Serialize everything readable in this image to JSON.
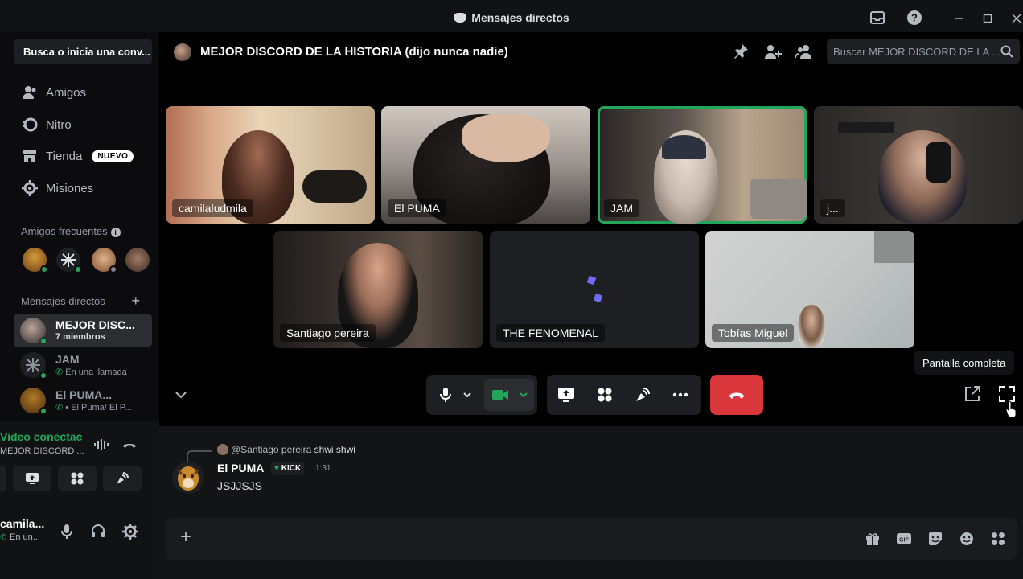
{
  "window": {
    "title": "Mensajes directos"
  },
  "sidebar": {
    "search_label": "Busca o inicia una conv...",
    "nav": [
      {
        "label": "Amigos",
        "icon": "friends-icon"
      },
      {
        "label": "Nitro",
        "icon": "nitro-icon"
      },
      {
        "label": "Tienda",
        "icon": "shop-icon",
        "badge": "NUEVO"
      },
      {
        "label": "Misiones",
        "icon": "quests-icon"
      }
    ],
    "frequent_header": "Amigos frecuentes",
    "dm_header": "Mensajes directos",
    "dms": [
      {
        "name": "MEJOR DISC...",
        "sub": "7 miembros",
        "active": true
      },
      {
        "name": "JAM",
        "sub": "En una llamada",
        "active": false
      },
      {
        "name": "El PUMA...",
        "sub": "• El Puma/ El P...",
        "active": false
      }
    ],
    "voice": {
      "status": "Video conectac",
      "channel": "MEJOR DISCORD ..."
    },
    "user": {
      "name": "camila...",
      "status": "En un..."
    }
  },
  "header": {
    "title": "MEJOR DISCORD DE LA HISTORIA (dijo nunca nadie)",
    "search_placeholder": "Buscar MEJOR DISCORD DE LA ..."
  },
  "participants": [
    {
      "name": "camilaludmila",
      "speaking": false
    },
    {
      "name": "El PUMA",
      "speaking": false
    },
    {
      "name": "JAM",
      "speaking": true
    },
    {
      "name": "j...",
      "speaking": false
    },
    {
      "name": "Santiago pereira",
      "speaking": false
    },
    {
      "name": "THE FENOMENAL",
      "speaking": false
    },
    {
      "name": "Tobías Miguel",
      "speaking": false
    }
  ],
  "tooltip": "Pantalla completa",
  "chat": {
    "reply_to": "@Santiago pereira",
    "reply_text": "shwi shwi",
    "author": "El PUMA",
    "author_tag": "KICK",
    "time": "1:31",
    "text": "JSJJSJS"
  },
  "colors": {
    "online": "#23a55a",
    "hangup": "#da373c",
    "speaking_border": "#23a55a"
  }
}
